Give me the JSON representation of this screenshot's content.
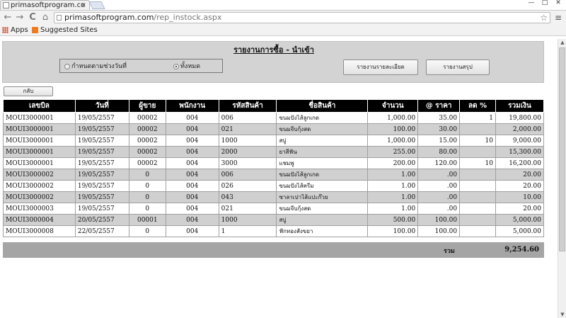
{
  "browser": {
    "tab_title": "primasoftprogram.co",
    "tab_close": "×",
    "window_minimize": "—",
    "window_maximize": "□",
    "window_close": "✕",
    "url_host": "primasoftprogram.com",
    "url_path": "/rep_instock.aspx",
    "back_icon": "←",
    "forward_icon": "→",
    "reload_icon": "C",
    "home_icon": "⌂",
    "star_icon": "☆",
    "menu_icon": "≡",
    "bookmarks": [
      {
        "label": "Apps"
      },
      {
        "label": "Suggested Sites"
      }
    ]
  },
  "report": {
    "title": "รายงานการซื้อ - นำเข้า",
    "radio_date_range": "กำหนดตามช่วงวันที่",
    "radio_all": "ทั้งหมด",
    "radio_selected": "all",
    "btn_detail": "รายงานรายละเอียด",
    "btn_summary": "รายงานสรุป",
    "btn_back": "กลับ"
  },
  "table": {
    "headers": [
      "เลขบิล",
      "วันที่",
      "ผู้ขาย",
      "พนักงาน",
      "รหัสสินค้า",
      "ชื่อสินค้า",
      "จำนวน",
      "@ ราคา",
      "ลด %",
      "รวมเงิน"
    ],
    "rows": [
      [
        "MOUI3000001",
        "19/05/2557",
        "00002",
        "004",
        "006",
        "ขนมปังไส้ลูกเกด",
        "1,000.00",
        "35.00",
        "1",
        "19,800.00"
      ],
      [
        "MOUI3000001",
        "19/05/2557",
        "00002",
        "004",
        "021",
        "ขนมจีบกุ้งสด",
        "100.00",
        "30.00",
        "",
        "2,000.00"
      ],
      [
        "MOUI3000001",
        "19/05/2557",
        "00002",
        "004",
        "1000",
        "สบู่",
        "1,000.00",
        "15.00",
        "10",
        "9,000.00"
      ],
      [
        "MOUI3000001",
        "19/05/2557",
        "00002",
        "004",
        "2000",
        "ยาสีฟัน",
        "255.00",
        "80.00",
        "",
        "15,300.00"
      ],
      [
        "MOUI3000001",
        "19/05/2557",
        "00002",
        "004",
        "3000",
        "แชมพู",
        "200.00",
        "120.00",
        "10",
        "16,200.00"
      ],
      [
        "MOUI3000002",
        "19/05/2557",
        "0",
        "004",
        "006",
        "ขนมปังไส้ลูกเกด",
        "1.00",
        ".00",
        "",
        "20.00"
      ],
      [
        "MOUI3000002",
        "19/05/2557",
        "0",
        "004",
        "026",
        "ขนมปังไส้ครีม",
        "1.00",
        ".00",
        "",
        "20.00"
      ],
      [
        "MOUI3000002",
        "19/05/2557",
        "0",
        "004",
        "043",
        "ซาลาเปาไส้แปะก๊วย",
        "1.00",
        ".00",
        "",
        "10.00"
      ],
      [
        "MOUI3000003",
        "19/05/2557",
        "0",
        "004",
        "021",
        "ขนมจีบกุ้งสด",
        "1.00",
        ".00",
        "",
        "20.00"
      ],
      [
        "MOUI3000004",
        "20/05/2557",
        "00001",
        "004",
        "1000",
        "สบู่",
        "500.00",
        "100.00",
        "",
        "5,000.00"
      ],
      [
        "MOUI3000008",
        "22/05/2557",
        "0",
        "004",
        "1",
        "ฟักทองสังขยา",
        "100.00",
        "100.00",
        "",
        "5,000.00"
      ]
    ],
    "total_label": "รวม",
    "total_value": "9,254.60"
  }
}
